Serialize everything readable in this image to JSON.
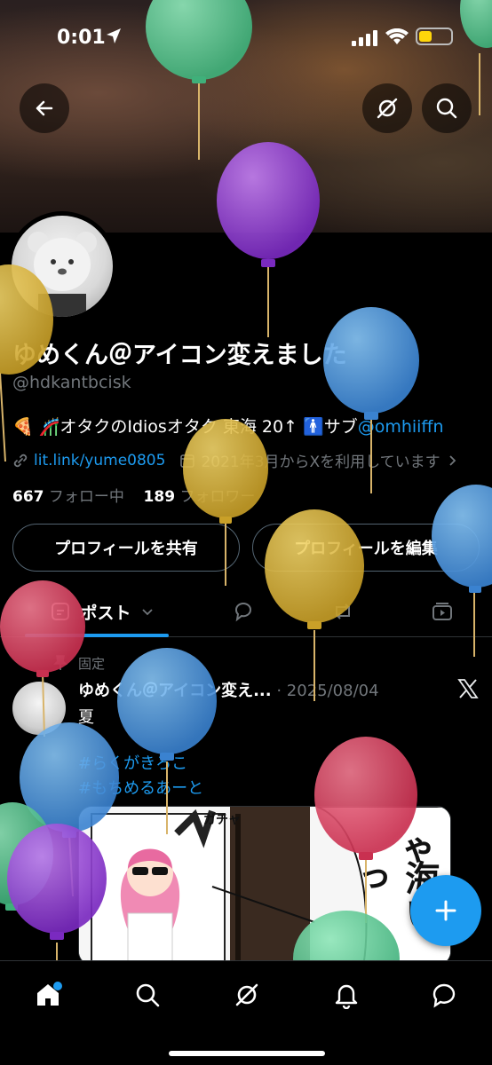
{
  "status_bar": {
    "time": "0:01"
  },
  "colors": {
    "accent": "#1d9bf0",
    "battery": "#ffd60a"
  },
  "profile": {
    "display_name": "ゆめくん＠アイコン変えました",
    "handle": "@hdkantbcisk",
    "bio_text": "🍕 🎢オタクのIdiosオタク 東海 20↑ 🚹サブ",
    "bio_mention": "@omhiiffn",
    "link": "lit.link/yume0805",
    "joined": "2021年3月からXを利用しています",
    "following_count": "667",
    "following_label": "フォロー中",
    "followers_count": "189",
    "followers_label": "フォロワー"
  },
  "buttons": {
    "share": "プロフィールを共有",
    "edit": "プロフィールを編集"
  },
  "tabs": {
    "posts": "ポスト"
  },
  "post": {
    "pinned_label": "固定",
    "author": "ゆめくん＠アイコン変え...",
    "date": "· 2025/08/04",
    "text": "夏",
    "hashtags": [
      "#らくがきろこ",
      "#もちめるあーと"
    ],
    "image_text": {
      "sfx": "ガチャ",
      "col1": "ろこちゃ",
      "col2": "海いっ"
    }
  }
}
